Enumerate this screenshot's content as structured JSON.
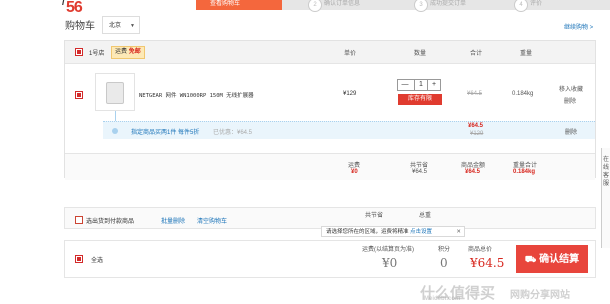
{
  "logo": {
    "mark": "56",
    "slash": "/"
  },
  "steps": [
    {
      "num": "1",
      "label": "查看购物车"
    },
    {
      "num": "2",
      "label": "确认订单信息"
    },
    {
      "num": "3",
      "label": "成功提交订单"
    },
    {
      "num": "4",
      "label": "评价"
    }
  ],
  "page_title": "购物车",
  "region": {
    "value": "北京",
    "icon": "chevron-down-icon"
  },
  "continue_shopping": "继续购物 >",
  "store": {
    "name": "1号店",
    "shipping_label": "运费",
    "shipping_value": "免邮"
  },
  "columns": {
    "price": "单价",
    "qty": "数量",
    "total": "合计",
    "weight": "重量"
  },
  "item": {
    "title": "NETGEAR 网件 WN1000RP 150M 无线扩展器",
    "price": "¥129",
    "qty": "1",
    "qty_minus": "—",
    "qty_plus": "+",
    "stock_button": "库存有限",
    "total_struck": "¥64.5",
    "weight": "0.184kg",
    "move_fav": "移入收藏",
    "delete": "删除"
  },
  "promo": {
    "text": "指定商品买两1件 每件5折",
    "discount": "已优惠：¥64.5",
    "total": "¥64.5",
    "original": "¥129",
    "delete": "删除"
  },
  "store_summary": {
    "shipping_label": "运费",
    "shipping_value": "¥0",
    "saved_label": "共节省",
    "saved_value": "¥64.5",
    "amount_label": "商品金额",
    "amount_value": "¥64.5",
    "weight_label": "重量合计",
    "weight_value": "0.184kg"
  },
  "bottom_actions": {
    "select_goods": "选出货到付款商品",
    "batch_delete": "批量删除",
    "clear_cart": "清空购物车",
    "saved_label": "共节省",
    "weight_label": "总重"
  },
  "tooltip": {
    "text": "请选择您所在的区域，运费将精准",
    "link": "点击设置",
    "close": "✕"
  },
  "checkout": {
    "select_all": "全选",
    "shipping_label": "运费(以结算页为准)",
    "shipping_value": "¥0",
    "points_label": "积分",
    "points_value": "0",
    "total_label": "商品总价",
    "total_value": "¥64.5",
    "button": "确认结算",
    "button_icon": "cart-icon"
  },
  "side_tab": "在线客服",
  "watermark": {
    "main": "什么值得买",
    "sub": "Meidebi.com",
    "right": "网购分享网站"
  }
}
